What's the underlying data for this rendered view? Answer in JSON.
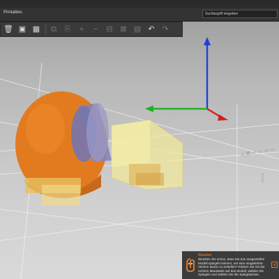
{
  "app": {
    "title": "Printables"
  },
  "search": {
    "placeholder": "Suchbegriff eingeben"
  },
  "toolbar": {
    "items": [
      {
        "icon": "trash-icon"
      },
      {
        "icon": "fit-view-icon"
      },
      {
        "icon": "arrange-icon"
      },
      {
        "icon": "copy-icon"
      },
      {
        "icon": "paste-icon"
      },
      {
        "icon": "add-icon"
      },
      {
        "icon": "remove-icon"
      },
      {
        "icon": "grid-icon"
      },
      {
        "icon": "undo-icon"
      },
      {
        "icon": "redo-icon"
      }
    ]
  },
  "tip": {
    "title": "Wussten",
    "body": "Wussten Sie schon, dass Sie das ausgewählte Modell spiegeln können, um eine umgekehrte Version davon zu erstellen? Klicken Sie mit der rechten Maustaste auf das Modell, wählen Sie Spiegeln und wählen Sie die Spiegelachse.",
    "close_glyph": "✕"
  },
  "colors": {
    "orange_model": "#e07a1f",
    "blue_cylinder": "#7f7fb6",
    "yellow_box": "#f1e89a",
    "axis_x": "#d31b1b",
    "axis_y": "#24b227",
    "axis_z": "#1f3fd8",
    "tip_accent": "#ff6a1a"
  }
}
